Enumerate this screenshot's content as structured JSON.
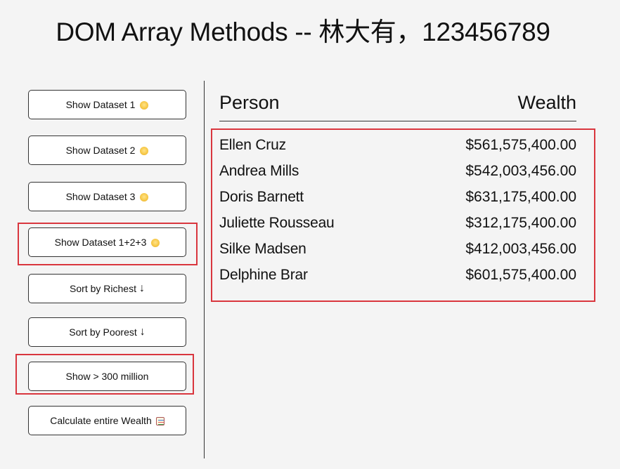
{
  "page": {
    "title": "DOM Array Methods -- 林大有，123456789"
  },
  "sidebar": {
    "buttons": [
      {
        "label": "Show Dataset 1",
        "icon": "face-emoji-icon"
      },
      {
        "label": "Show Dataset 2",
        "icon": "face-emoji-icon"
      },
      {
        "label": "Show Dataset 3",
        "icon": "face-emoji-icon"
      },
      {
        "label": "Show Dataset 1+2+3",
        "icon": "face-emoji-icon"
      },
      {
        "label": "Sort by Richest",
        "icon": "arrow-down-icon",
        "glyph": "↓"
      },
      {
        "label": "Sort by Poorest",
        "icon": "arrow-down-icon",
        "glyph": "↓"
      },
      {
        "label": "Show > 300 million",
        "icon": ""
      },
      {
        "label": "Calculate entire Wealth",
        "icon": "abacus-icon"
      }
    ]
  },
  "main": {
    "headers": {
      "person": "Person",
      "wealth": "Wealth"
    },
    "rows": [
      {
        "name": "Ellen Cruz",
        "wealth": "$561,575,400.00"
      },
      {
        "name": "Andrea Mills",
        "wealth": "$542,003,456.00"
      },
      {
        "name": "Doris Barnett",
        "wealth": "$631,175,400.00"
      },
      {
        "name": "Juliette Rousseau",
        "wealth": "$312,175,400.00"
      },
      {
        "name": "Silke Madsen",
        "wealth": "$412,003,456.00"
      },
      {
        "name": "Delphine Brar",
        "wealth": "$601,575,400.00"
      }
    ]
  },
  "colors": {
    "background": "#f4f4f4",
    "highlight": "#d9363e",
    "button_bg": "#ffffff",
    "text": "#111111"
  }
}
